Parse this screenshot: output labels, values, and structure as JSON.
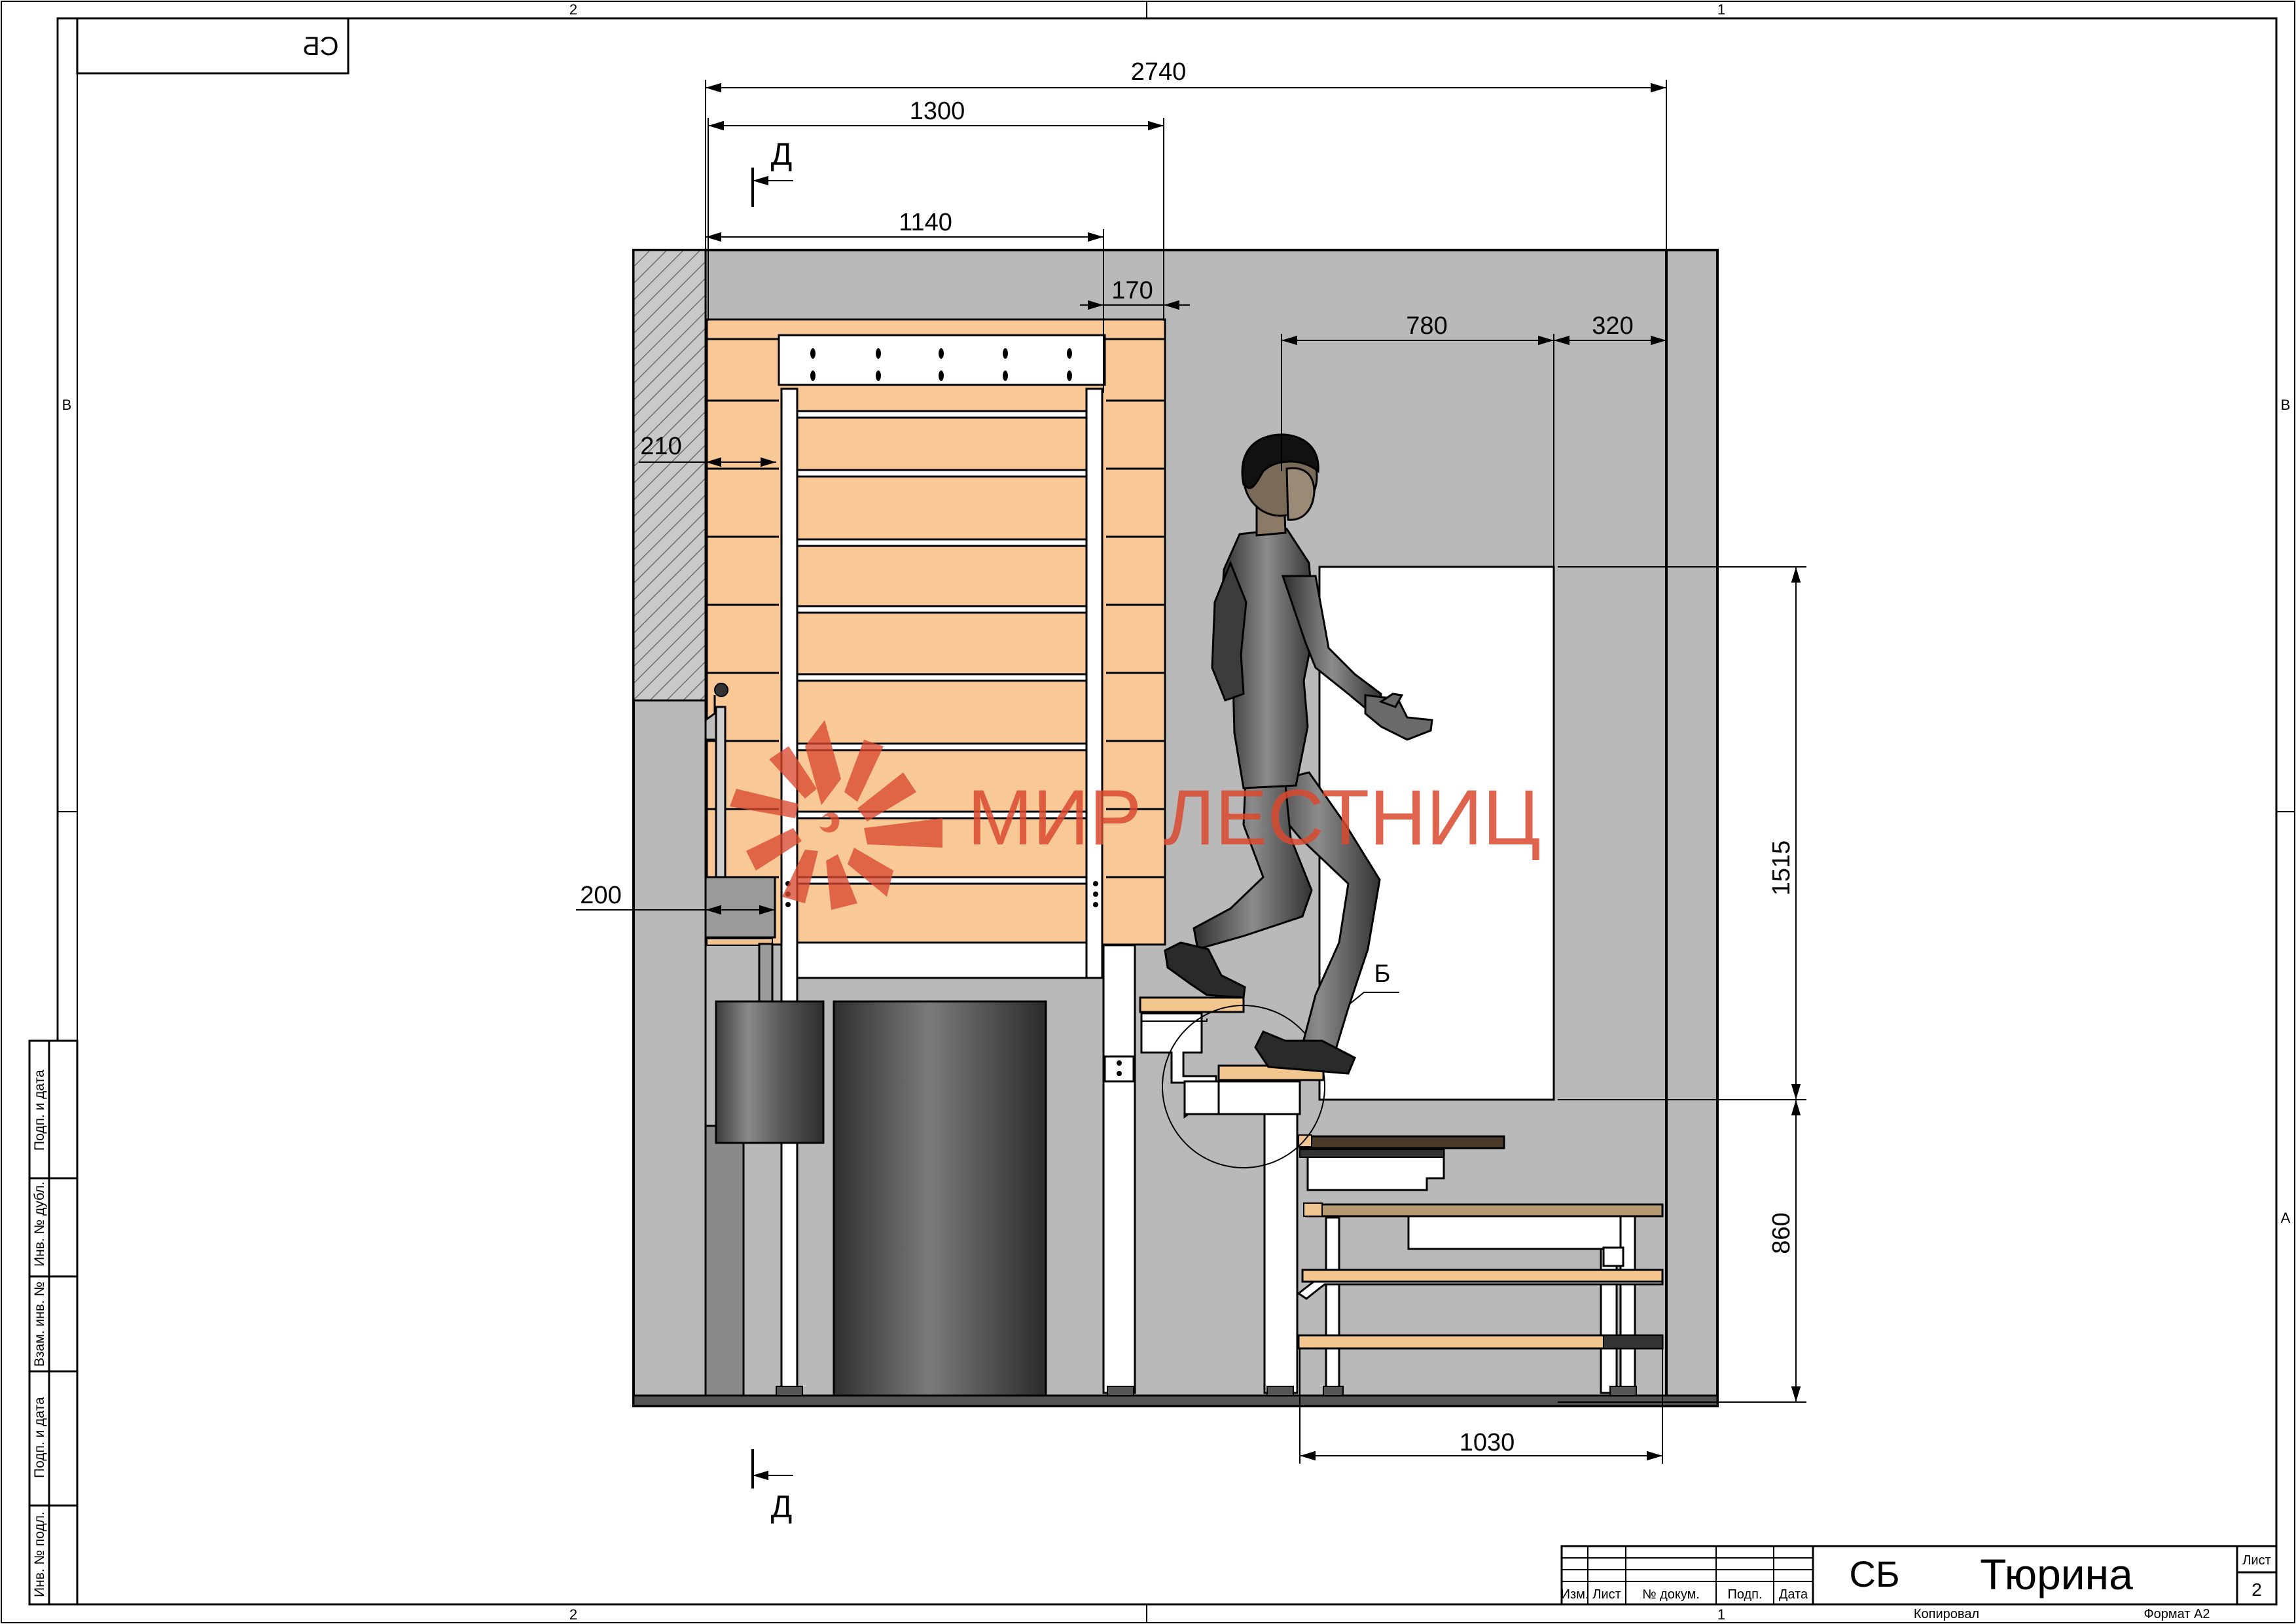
{
  "sheet": {
    "mirrored_code": "СБ",
    "zone_top_left": "2",
    "zone_top_right": "1",
    "zone_bottom_left": "2",
    "zone_bottom_right": "1",
    "zone_side_b": "В",
    "zone_side_a": "А"
  },
  "dimensions": {
    "overall": "2740",
    "width_1300": "1300",
    "width_1140": "1140",
    "width_170": "170",
    "width_780": "780",
    "width_320": "320",
    "offset_210": "210",
    "offset_200": "200",
    "height_1515": "1515",
    "height_860": "860",
    "width_1030": "1030"
  },
  "callouts": {
    "section_top": "Д",
    "section_bottom": "Д",
    "detail": "Б"
  },
  "watermark": {
    "text": "МИР ЛЕСТНИЦ",
    "color": "#d9492f"
  },
  "side_stamps": [
    "Подп. и дата",
    "Инв. № дубл.",
    "Взам. инв. №",
    "Подп. и дата",
    "Инв. № подл."
  ],
  "title_block": {
    "headers": [
      "Изм.",
      "Лист",
      "№ докум.",
      "Подп.",
      "Дата"
    ],
    "code": "СБ",
    "name": "Тюрина",
    "sheet_label": "Лист",
    "sheet_number": "2",
    "copied_label": "Копировал",
    "format_label": "Формат А2"
  },
  "colors": {
    "wall": "#b9b9b9",
    "wood": "#f8c897",
    "tread": "#f3c690",
    "frame_white": "#ffffff",
    "stove": "#5a5a5a",
    "hatch": "#8c8c8c",
    "mannequin": "#4d4d4d"
  }
}
